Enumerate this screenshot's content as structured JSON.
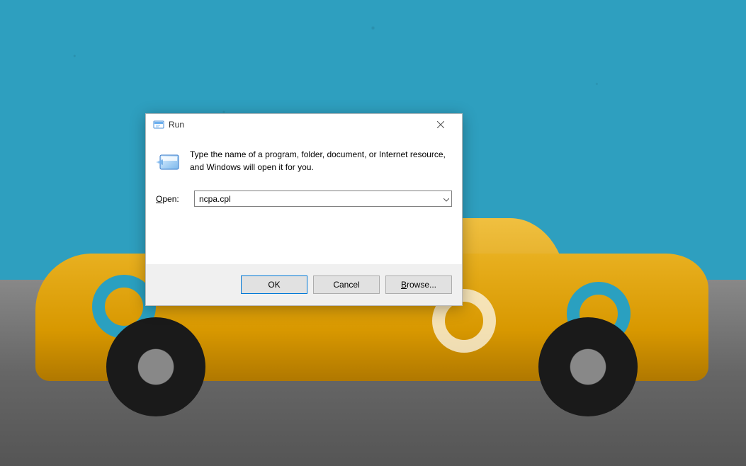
{
  "dialog": {
    "title": "Run",
    "description": "Type the name of a program, folder, document, or Internet resource, and Windows will open it for you.",
    "open_label_prefix": "O",
    "open_label_rest": "pen:",
    "input_value": "ncpa.cpl",
    "buttons": {
      "ok": "OK",
      "cancel": "Cancel",
      "browse_prefix": "B",
      "browse_rest": "rowse..."
    }
  }
}
